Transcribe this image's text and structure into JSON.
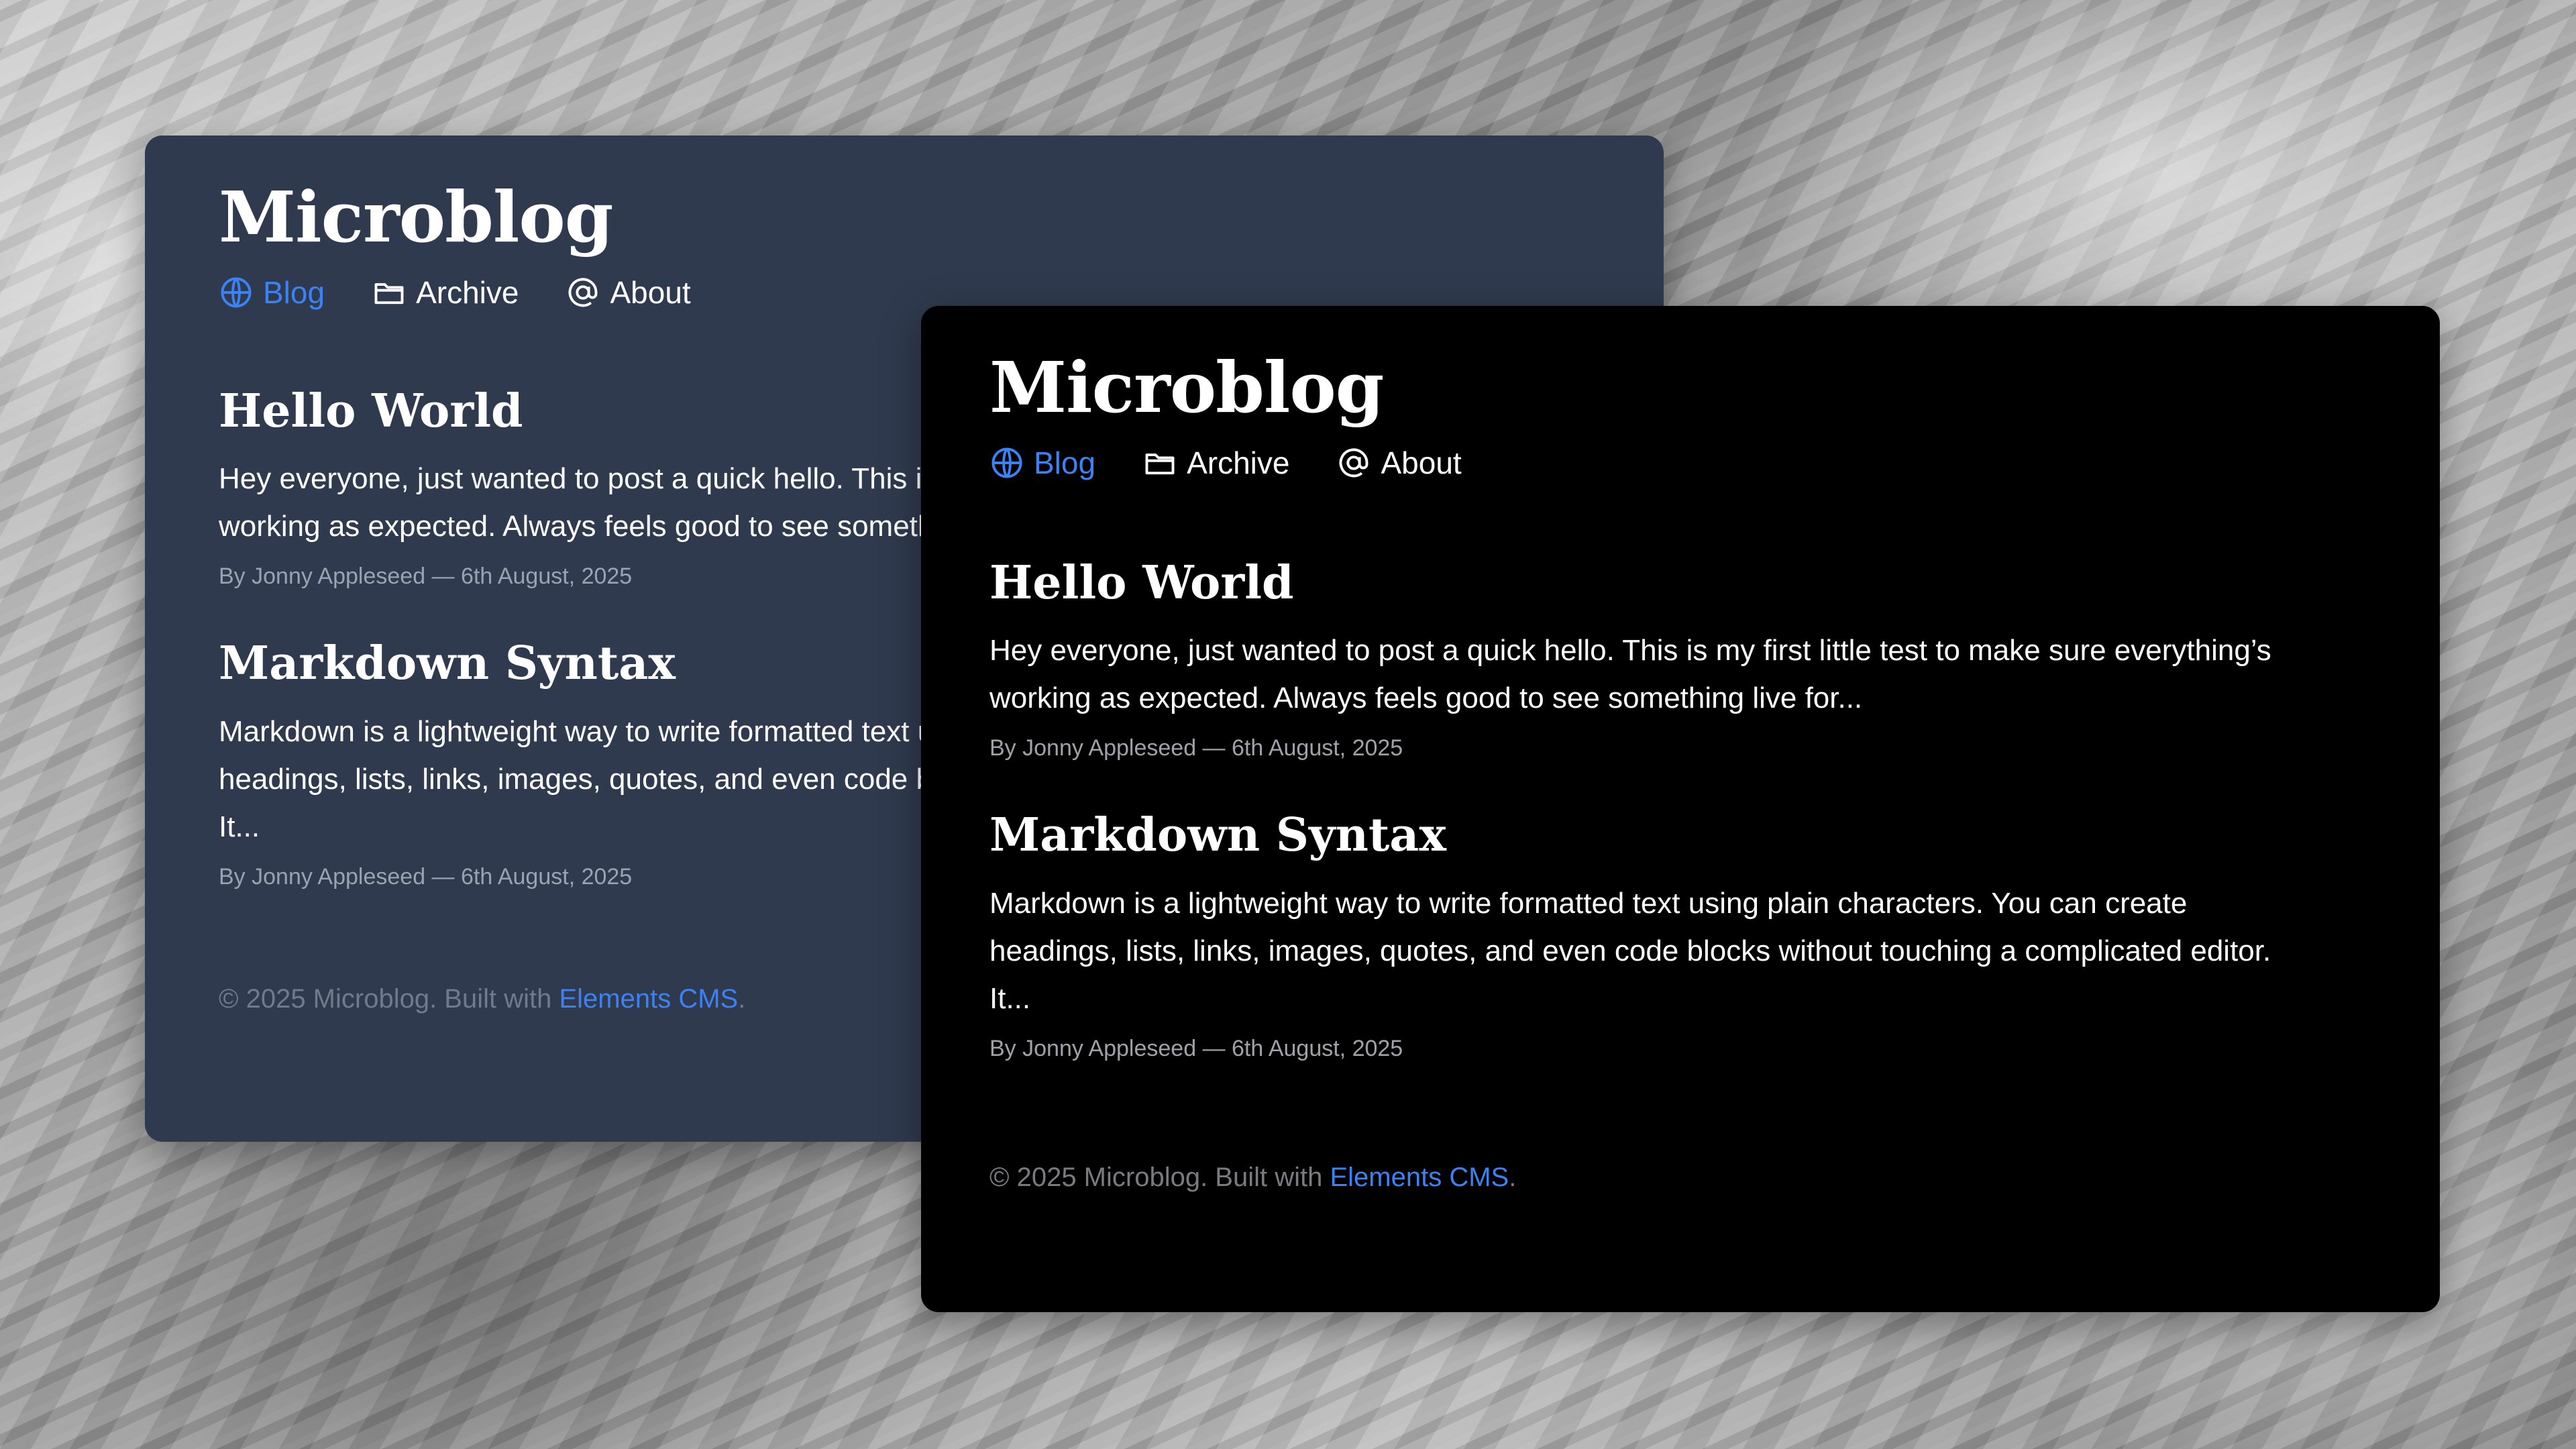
{
  "site": {
    "title": "Microblog"
  },
  "nav": [
    {
      "label": "Blog",
      "icon": "globe-icon",
      "active": true
    },
    {
      "label": "Archive",
      "icon": "folder-icon",
      "active": false
    },
    {
      "label": "About",
      "icon": "at-sign-icon",
      "active": false
    }
  ],
  "posts": [
    {
      "title": "Hello World",
      "excerpt": "Hey everyone, just wanted to post a quick hello. This is my first little test to make sure everything’s working as expected. Always feels good to see something live for...",
      "meta": "By Jonny Appleseed — 6th August, 2025"
    },
    {
      "title": "Markdown Syntax",
      "excerpt": "Markdown is a lightweight way to write formatted text using plain characters. You can create headings, lists, links, images, quotes, and even code blocks without touching a complicated editor. It...",
      "meta": "By Jonny Appleseed — 6th August, 2025"
    }
  ],
  "footer": {
    "prefix": "© 2025 Microblog. Built with ",
    "link_label": "Elements CMS",
    "suffix": "."
  },
  "colors": {
    "accent": "#3b82f6",
    "slate_panel_bg": "#2f3a4e",
    "black_panel_bg": "#000000"
  }
}
